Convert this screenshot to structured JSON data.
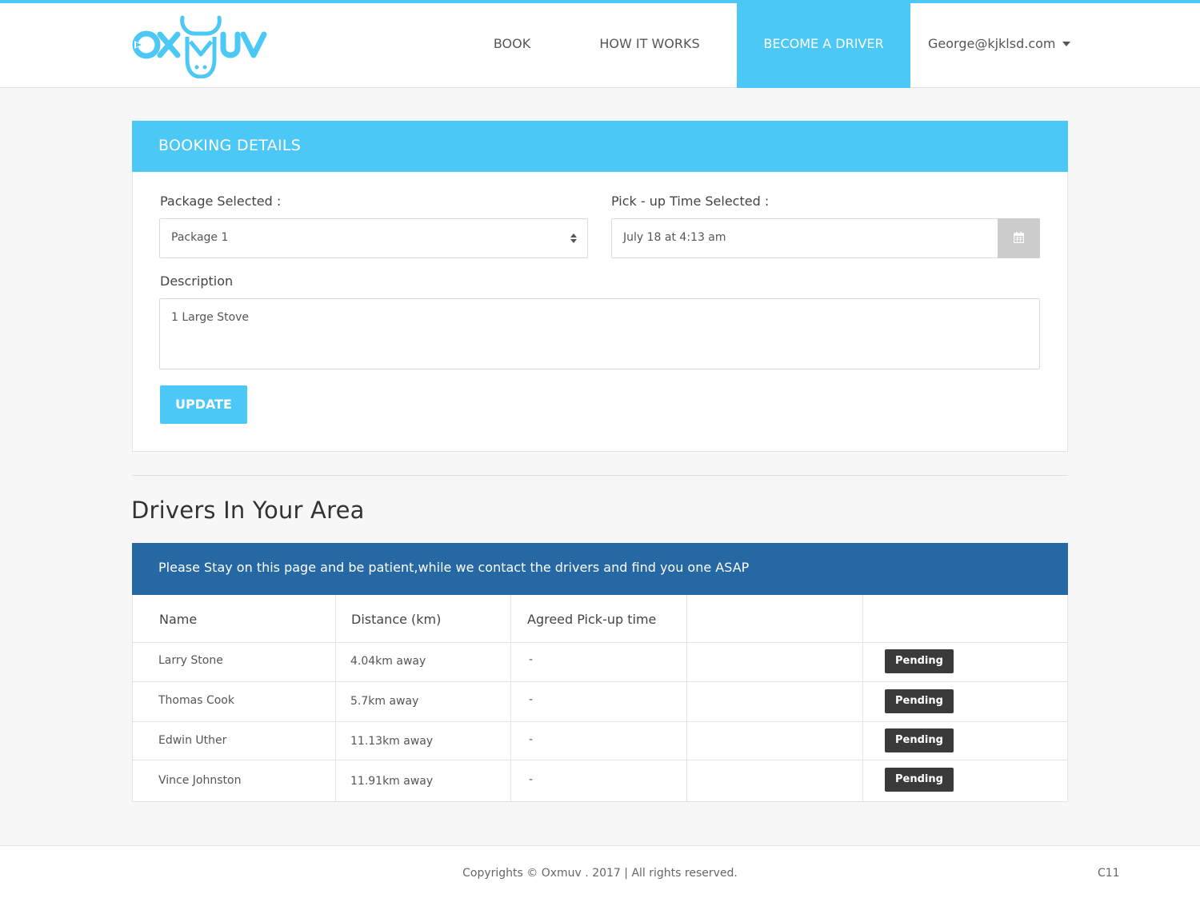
{
  "brand": {
    "logo_text": "OXMUV",
    "accent_color": "#4bc8f5",
    "banner_color": "#2568a3"
  },
  "nav": {
    "book": "BOOK",
    "how_it_works": "HOW IT WORKS",
    "become_driver": "BECOME A DRIVER",
    "user_email": "George@kjklsd.com"
  },
  "booking": {
    "title": "BOOKING DETAILS",
    "package_label": "Package Selected :",
    "package_value": "Package 1",
    "pickup_label": "Pick - up Time Selected :",
    "pickup_value": "July 18 at 4:13 am",
    "description_label": "Description",
    "description_value": "1 Large Stove",
    "update_button": "UPDATE"
  },
  "drivers": {
    "section_title": "Drivers In Your Area",
    "notice": "Please Stay on this page and be patient,while we contact the drivers and find you one ASAP",
    "columns": [
      "Name",
      "Distance (km)",
      "Agreed Pick-up time",
      "",
      ""
    ],
    "rows": [
      {
        "name": "Larry Stone",
        "distance": "4.04km away",
        "pickup": "-",
        "status": "Pending"
      },
      {
        "name": "Thomas Cook",
        "distance": "5.7km away",
        "pickup": "-",
        "status": "Pending"
      },
      {
        "name": "Edwin Uther",
        "distance": "11.13km away",
        "pickup": "-",
        "status": "Pending"
      },
      {
        "name": "Vince Johnston",
        "distance": "11.91km away",
        "pickup": "-",
        "status": "Pending"
      }
    ]
  },
  "footer": {
    "copyright": "Copyrights © Oxmuv . 2017 | All rights reserved.",
    "code": "C11"
  }
}
